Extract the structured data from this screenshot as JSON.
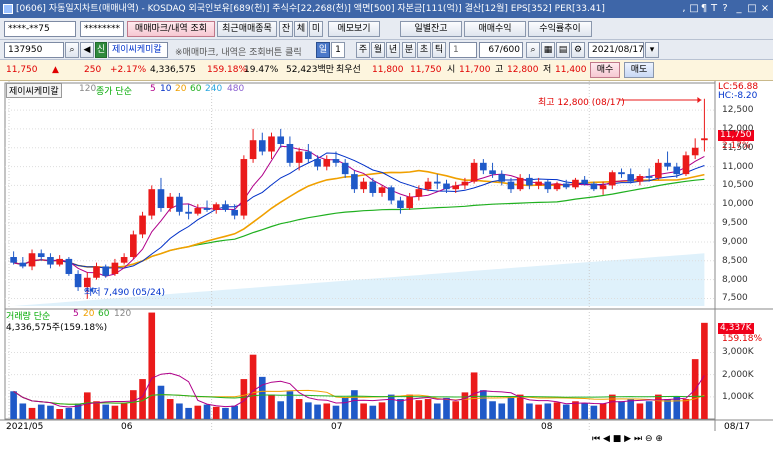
{
  "window": {
    "title": "[0606] 자동일지차트(매매내역) - KOSDAQ 외국인보유[689(천)] 주식수[22,268(천)] 액면[500] 자본금[111(억)] 결산[12월] EPS[352] PER[33.41]",
    "controls": [
      ",",
      "□",
      "¶",
      "T",
      "?",
      "_",
      "□",
      "×"
    ]
  },
  "toolbar1": {
    "account": "****-**75",
    "password": "********",
    "buttons": [
      "매매마크/내역 조회",
      "최근매매종목",
      "잔",
      "체",
      "미",
      "메모보기",
      "일별잔고",
      "매매수익",
      "수익률추이"
    ]
  },
  "toolbar2": {
    "code": "137950",
    "badge": "신",
    "name": "제이씨케미칼",
    "hint": "※매매마크, 내역은 조회버튼 클릭",
    "periods": [
      "일",
      "1",
      "주",
      "월",
      "년",
      "분",
      "초",
      "틱"
    ],
    "tick_sel": "1",
    "count": "67/600",
    "date": "2021/08/17"
  },
  "quote": {
    "price": "11,750",
    "change": "250",
    "change_pct": "+2.17%",
    "volume": "4,336,575",
    "vol_ratio": "159.18%",
    "turnover": "19.47%",
    "amount": "52,423백만",
    "priority": "최우선",
    "ask": "11,800",
    "bid": "11,750",
    "open_label": "시",
    "open": "11,700",
    "high_label": "고",
    "high": "12,800",
    "low_label": "저",
    "low": "11,400",
    "buy": "매수",
    "sell": "매도"
  },
  "price_panel": {
    "name": "제이씨케미칼",
    "count": "120",
    "ma_title": "종가 단순",
    "ma_periods": [
      "5",
      "10",
      "20",
      "60",
      "240",
      "480"
    ],
    "ma_colors": [
      "#b0008a",
      "#0030c8",
      "#f0a000",
      "#20b020",
      "#2aa7e0",
      "#8a5fd0"
    ],
    "lc": "LC:56.88",
    "hc": "HC:-8.20",
    "max_label": "최고 12,800 (08/17)",
    "min_label": "최저 7,490 (05/24)",
    "price_tag": "11,750",
    "pct_tag": "2.17%",
    "yticks": [
      "12,500",
      "12,000",
      "11,500",
      "11,000",
      "10,500",
      "10,000",
      "9,500",
      "9,000",
      "8,500",
      "8,000",
      "7,500"
    ]
  },
  "volume_panel": {
    "title": "거래량 단순",
    "ma_periods": [
      "5",
      "20",
      "60",
      "120"
    ],
    "value": "4,336,575주(159.18%)",
    "tag1": "4,337K",
    "tag2": "159.18%",
    "yticks": [
      "3,000K",
      "2,000K",
      "1,000K"
    ]
  },
  "xaxis": {
    "labels": [
      "2021/05",
      "06",
      "07",
      "08"
    ],
    "end_label": "08/17"
  },
  "chart_data": {
    "type": "candlestick",
    "categories_note": "daily candles 2021/05 to 2021/08/17",
    "candles": [
      [
        8600,
        8750,
        8400,
        8450
      ],
      [
        8450,
        8600,
        8300,
        8350
      ],
      [
        8350,
        8800,
        8250,
        8700
      ],
      [
        8700,
        8800,
        8500,
        8600
      ],
      [
        8600,
        8700,
        8300,
        8400
      ],
      [
        8400,
        8650,
        8350,
        8550
      ],
      [
        8550,
        8600,
        8100,
        8150
      ],
      [
        8150,
        8250,
        7700,
        7800
      ],
      [
        7800,
        8200,
        7490,
        8050
      ],
      [
        8050,
        8450,
        8000,
        8350
      ],
      [
        8350,
        8400,
        8050,
        8100
      ],
      [
        8150,
        8550,
        8100,
        8450
      ],
      [
        8450,
        8700,
        8400,
        8600
      ],
      [
        8600,
        9300,
        8550,
        9200
      ],
      [
        9200,
        9800,
        9100,
        9700
      ],
      [
        9700,
        10500,
        9600,
        10400
      ],
      [
        10400,
        10700,
        9800,
        9900
      ],
      [
        9900,
        10300,
        9800,
        10200
      ],
      [
        10200,
        10300,
        9700,
        9800
      ],
      [
        9800,
        10000,
        9600,
        9750
      ],
      [
        9750,
        10000,
        9700,
        9900
      ],
      [
        9900,
        10100,
        9800,
        9850
      ],
      [
        9850,
        10050,
        9750,
        10000
      ],
      [
        10000,
        10100,
        9800,
        9850
      ],
      [
        9850,
        10000,
        9600,
        9700
      ],
      [
        9700,
        11300,
        9600,
        11200
      ],
      [
        11200,
        12000,
        11100,
        11700
      ],
      [
        11700,
        11900,
        11300,
        11400
      ],
      [
        11400,
        11900,
        11200,
        11800
      ],
      [
        11800,
        12000,
        11500,
        11600
      ],
      [
        11600,
        11800,
        11000,
        11100
      ],
      [
        11100,
        11500,
        10900,
        11400
      ],
      [
        11400,
        11600,
        11100,
        11200
      ],
      [
        11200,
        11300,
        10900,
        11000
      ],
      [
        11000,
        11300,
        10900,
        11200
      ],
      [
        11200,
        11400,
        11000,
        11100
      ],
      [
        11100,
        11200,
        10700,
        10800
      ],
      [
        10800,
        10900,
        10300,
        10400
      ],
      [
        10400,
        10700,
        10300,
        10600
      ],
      [
        10600,
        10700,
        10200,
        10300
      ],
      [
        10300,
        10500,
        10200,
        10450
      ],
      [
        10450,
        10500,
        10000,
        10100
      ],
      [
        10100,
        10200,
        9750,
        9900
      ],
      [
        9900,
        10300,
        9850,
        10200
      ],
      [
        10200,
        10500,
        10100,
        10400
      ],
      [
        10400,
        10700,
        10350,
        10600
      ],
      [
        10600,
        10800,
        10400,
        10550
      ],
      [
        10550,
        10650,
        10300,
        10400
      ],
      [
        10400,
        10600,
        10300,
        10500
      ],
      [
        10500,
        10700,
        10400,
        10600
      ],
      [
        10600,
        11200,
        10550,
        11100
      ],
      [
        11100,
        11200,
        10800,
        10900
      ],
      [
        10900,
        11100,
        10700,
        10800
      ],
      [
        10800,
        10900,
        10500,
        10600
      ],
      [
        10600,
        10700,
        10300,
        10400
      ],
      [
        10400,
        10800,
        10350,
        10700
      ],
      [
        10700,
        10800,
        10400,
        10500
      ],
      [
        10500,
        10700,
        10400,
        10600
      ],
      [
        10600,
        10650,
        10300,
        10400
      ],
      [
        10400,
        10600,
        10350,
        10550
      ],
      [
        10550,
        10650,
        10400,
        10450
      ],
      [
        10450,
        10700,
        10400,
        10650
      ],
      [
        10650,
        10750,
        10500,
        10550
      ],
      [
        10550,
        10600,
        10350,
        10400
      ],
      [
        10400,
        10600,
        10250,
        10500
      ],
      [
        10500,
        10900,
        10400,
        10850
      ],
      [
        10850,
        10950,
        10700,
        10800
      ],
      [
        10800,
        10950,
        10550,
        10600
      ],
      [
        10600,
        10800,
        10500,
        10750
      ],
      [
        10750,
        10950,
        10600,
        10700
      ],
      [
        10700,
        11200,
        10650,
        11100
      ],
      [
        11100,
        11400,
        10900,
        11000
      ],
      [
        11000,
        11100,
        10700,
        10800
      ],
      [
        10800,
        11400,
        10750,
        11300
      ],
      [
        11300,
        11750,
        11200,
        11500
      ],
      [
        11700,
        12800,
        11400,
        11750
      ]
    ],
    "volumes": [
      1250,
      700,
      500,
      650,
      600,
      450,
      500,
      700,
      1200,
      800,
      650,
      600,
      700,
      1300,
      1800,
      4800,
      1500,
      900,
      700,
      500,
      600,
      650,
      550,
      500,
      600,
      1800,
      2900,
      1900,
      1100,
      800,
      1250,
      900,
      750,
      650,
      700,
      600,
      950,
      1300,
      700,
      600,
      750,
      1100,
      900,
      1100,
      850,
      900,
      700,
      950,
      800,
      1200,
      2100,
      1300,
      800,
      700,
      1000,
      1100,
      700,
      650,
      700,
      750,
      650,
      800,
      700,
      600,
      700,
      1100,
      800,
      900,
      700,
      800,
      1100,
      900,
      1000,
      900,
      2700,
      4337
    ],
    "ma_series": [
      "MA5",
      "MA10",
      "MA20",
      "MA60"
    ],
    "ylim": [
      7300,
      12900
    ],
    "vol_ylim": [
      0,
      4600
    ]
  }
}
